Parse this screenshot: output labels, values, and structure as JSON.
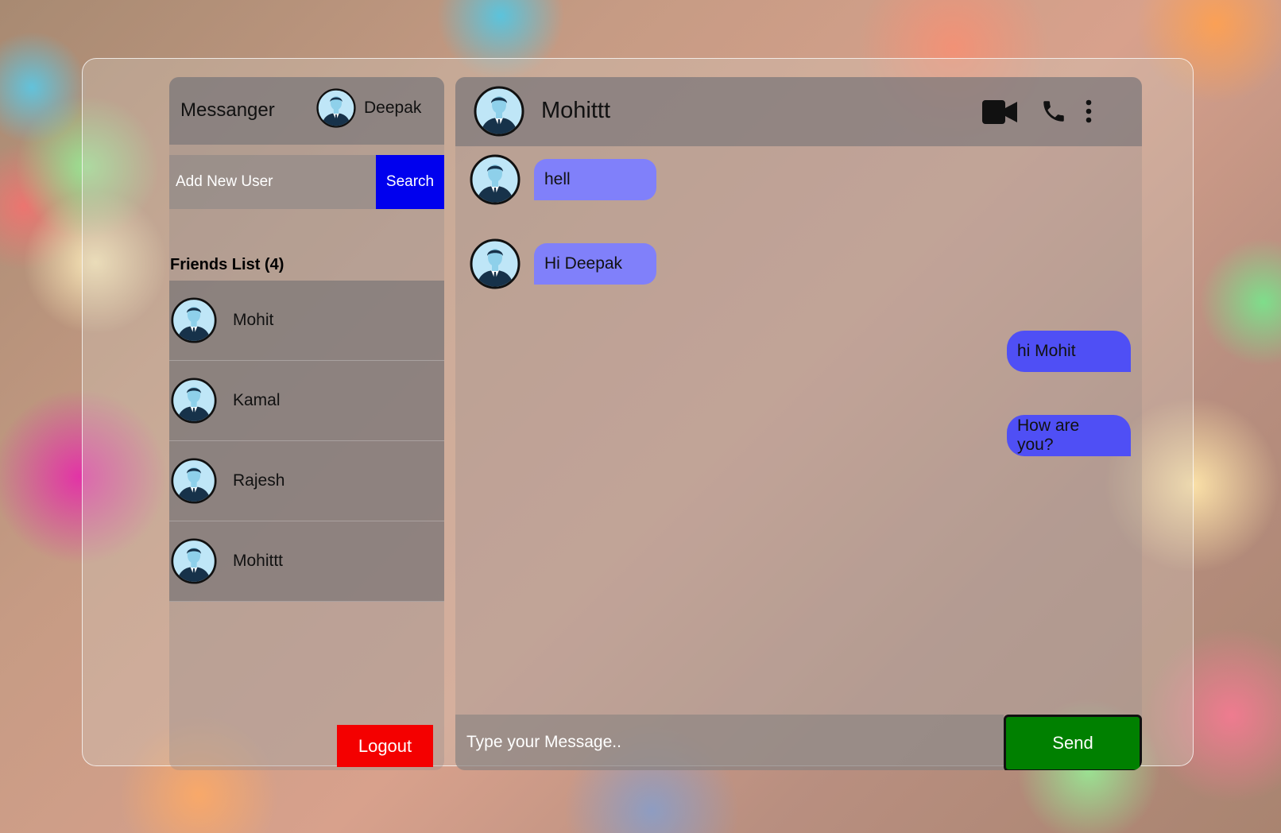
{
  "sidebar": {
    "brand": "Messanger",
    "current_user": "Deepak",
    "add_user_placeholder": "Add New User",
    "search_label": "Search",
    "friends_title": "Friends List (4)",
    "friends": [
      {
        "name": "Mohit"
      },
      {
        "name": "Kamal"
      },
      {
        "name": "Rajesh"
      },
      {
        "name": "Mohittt"
      }
    ],
    "logout_label": "Logout"
  },
  "chat": {
    "contact_name": "Mohittt",
    "icons": [
      "video-camera-icon",
      "phone-icon",
      "more-vertical-icon"
    ],
    "messages": [
      {
        "direction": "in",
        "text": "hell"
      },
      {
        "direction": "in",
        "text": "Hi Deepak"
      },
      {
        "direction": "out",
        "text": "hi Mohit"
      },
      {
        "direction": "out",
        "text": "How are you?"
      }
    ],
    "message_placeholder": "Type your Message..",
    "send_label": "Send"
  },
  "colors": {
    "search_button": "#0000ee",
    "logout_button": "#f40000",
    "send_button": "#008000",
    "incoming_bubble": "#8080fa",
    "outgoing_bubble": "#4f4ff5"
  }
}
